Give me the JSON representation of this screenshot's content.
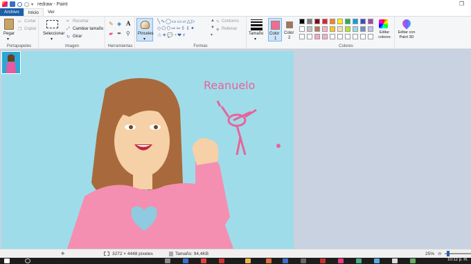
{
  "window": {
    "title": "redraw - Paint"
  },
  "tabs": [
    {
      "label": "Archivo"
    },
    {
      "label": "Inicio"
    },
    {
      "label": "Ver"
    }
  ],
  "ribbon": {
    "clipboard": {
      "paste": "Pegar",
      "cut": "Cortar",
      "copy": "Copiar",
      "group": "Portapapeles"
    },
    "image": {
      "select": "Seleccionar",
      "crop": "Recortar",
      "resize": "Cambiar tamaño",
      "rotate": "Girar",
      "group": "Imagen"
    },
    "tools": {
      "group": "Herramientas",
      "text_tool": "A"
    },
    "brushes": {
      "label": "Pinceles"
    },
    "shapes": {
      "outline": "Contorno",
      "fill": "Rellenar",
      "group": "Formas"
    },
    "size": {
      "label": "Tamaño"
    },
    "color1": {
      "label": "Color",
      "sub": "1"
    },
    "color2": {
      "label": "Color",
      "sub": "2"
    },
    "colors": {
      "group": "Colores",
      "edit": "Editar colores",
      "paint3d": "Editar con Paint 3D"
    }
  },
  "palette": {
    "row1": [
      "#000000",
      "#7f7f7f",
      "#880015",
      "#ed1c24",
      "#ff7f27",
      "#fff200",
      "#22b14c",
      "#00a2e8",
      "#3f48cc",
      "#a349a4"
    ],
    "row2": [
      "#ffffff",
      "#c3c3c3",
      "#b97a57",
      "#ffaec9",
      "#ffc90e",
      "#efe4b0",
      "#b5e61d",
      "#99d9ea",
      "#7092be",
      "#c8bfe7"
    ],
    "row3": [
      "#ffffff",
      "#ffffff",
      "#f7a6c0",
      "#f3b0c6",
      "#ffffff",
      "#ffffff",
      "#ffffff",
      "#ffffff",
      "#ffffff",
      "#ffffff"
    ]
  },
  "colors": {
    "color1": "#f46b8f",
    "color2": "#a8745a",
    "canvas_bg": "#9fdce9",
    "ribbon_bg": "#f5f6f7",
    "accent": "#1c5ea8"
  },
  "status": {
    "dimensions": "3272 × 4448 píxeles",
    "size": "Tamaño: 94,4KB",
    "zoom": "25%"
  },
  "canvas_text": {
    "handwriting": "Reanuelo"
  },
  "taskbar": {
    "time": "10:12 p. m."
  }
}
